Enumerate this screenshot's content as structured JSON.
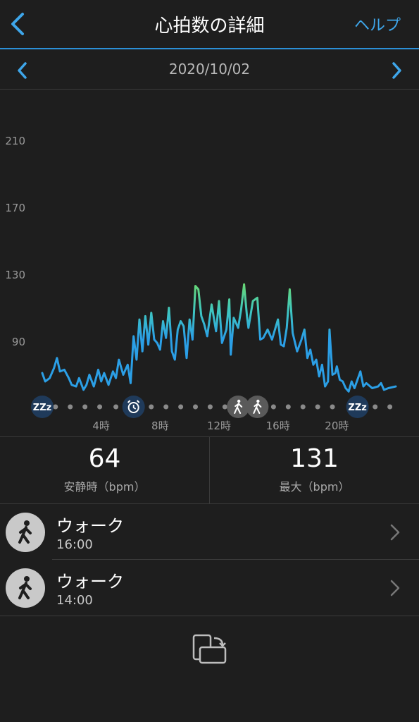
{
  "header": {
    "title": "心拍数の詳細",
    "help_label": "ヘルプ"
  },
  "datebar": {
    "date": "2020/10/02"
  },
  "colors": {
    "accent": "#3ea6ea",
    "line_low": "#2b9fe6",
    "line_high": "#7ee04a",
    "background": "#1e1e1e"
  },
  "chart_data": {
    "type": "line",
    "title": "",
    "xlabel": "",
    "ylabel": "",
    "x_unit": "hour",
    "xlim": [
      0,
      24
    ],
    "ylim": [
      50,
      220
    ],
    "y_ticks": [
      "210",
      "170",
      "130",
      "90"
    ],
    "y_tick_values": [
      210,
      170,
      130,
      90
    ],
    "x_ticks": [
      "4時",
      "8時",
      "12時",
      "16時",
      "20時"
    ],
    "x_tick_values": [
      4,
      8,
      12,
      16,
      20
    ],
    "grid": false,
    "series": [
      {
        "values": [
          [
            0.0,
            71
          ],
          [
            0.2,
            66
          ],
          [
            0.5,
            68
          ],
          [
            0.8,
            74
          ],
          [
            1.0,
            80
          ],
          [
            1.2,
            72
          ],
          [
            1.5,
            73
          ],
          [
            1.8,
            68
          ],
          [
            2.0,
            64
          ],
          [
            2.3,
            63
          ],
          [
            2.5,
            68
          ],
          [
            2.8,
            61
          ],
          [
            3.0,
            64
          ],
          [
            3.2,
            70
          ],
          [
            3.5,
            63
          ],
          [
            3.8,
            73
          ],
          [
            4.0,
            66
          ],
          [
            4.2,
            71
          ],
          [
            4.5,
            64
          ],
          [
            4.8,
            72
          ],
          [
            5.0,
            68
          ],
          [
            5.2,
            79
          ],
          [
            5.5,
            70
          ],
          [
            5.8,
            76
          ],
          [
            6.0,
            65
          ],
          [
            6.2,
            93
          ],
          [
            6.4,
            79
          ],
          [
            6.6,
            103
          ],
          [
            6.8,
            84
          ],
          [
            7.0,
            105
          ],
          [
            7.2,
            88
          ],
          [
            7.4,
            107
          ],
          [
            7.6,
            91
          ],
          [
            7.8,
            89
          ],
          [
            8.0,
            85
          ],
          [
            8.2,
            102
          ],
          [
            8.4,
            92
          ],
          [
            8.6,
            110
          ],
          [
            8.8,
            84
          ],
          [
            9.0,
            79
          ],
          [
            9.2,
            97
          ],
          [
            9.4,
            102
          ],
          [
            9.6,
            99
          ],
          [
            9.8,
            80
          ],
          [
            10.0,
            103
          ],
          [
            10.2,
            91
          ],
          [
            10.4,
            123
          ],
          [
            10.6,
            121
          ],
          [
            10.8,
            105
          ],
          [
            11.0,
            100
          ],
          [
            11.2,
            93
          ],
          [
            11.5,
            112
          ],
          [
            11.8,
            96
          ],
          [
            12.0,
            114
          ],
          [
            12.2,
            89
          ],
          [
            12.5,
            97
          ],
          [
            12.7,
            115
          ],
          [
            12.8,
            82
          ],
          [
            13.0,
            104
          ],
          [
            13.3,
            98
          ],
          [
            13.5,
            109
          ],
          [
            13.7,
            124
          ],
          [
            13.9,
            105
          ],
          [
            14.0,
            98
          ],
          [
            14.3,
            114
          ],
          [
            14.6,
            116
          ],
          [
            14.8,
            91
          ],
          [
            15.0,
            92
          ],
          [
            15.3,
            97
          ],
          [
            15.6,
            91
          ],
          [
            16.0,
            103
          ],
          [
            16.2,
            88
          ],
          [
            16.4,
            87
          ],
          [
            16.6,
            98
          ],
          [
            16.8,
            121
          ],
          [
            17.0,
            95
          ],
          [
            17.3,
            84
          ],
          [
            17.6,
            91
          ],
          [
            17.8,
            97
          ],
          [
            18.0,
            80
          ],
          [
            18.2,
            85
          ],
          [
            18.4,
            76
          ],
          [
            18.6,
            79
          ],
          [
            18.8,
            69
          ],
          [
            19.0,
            76
          ],
          [
            19.2,
            63
          ],
          [
            19.4,
            66
          ],
          [
            19.5,
            97
          ],
          [
            19.7,
            70
          ],
          [
            19.9,
            71
          ],
          [
            20.0,
            75
          ],
          [
            20.2,
            67
          ],
          [
            20.4,
            66
          ],
          [
            20.6,
            62
          ],
          [
            20.8,
            60
          ],
          [
            21.0,
            66
          ],
          [
            21.2,
            62
          ],
          [
            21.4,
            67
          ],
          [
            21.6,
            72
          ],
          [
            21.8,
            63
          ],
          [
            22.0,
            65
          ],
          [
            22.4,
            62
          ],
          [
            22.8,
            63
          ],
          [
            23.0,
            65
          ],
          [
            23.2,
            61
          ],
          [
            23.5,
            62
          ],
          [
            24.0,
            63
          ]
        ]
      }
    ],
    "event_markers": [
      {
        "x": 0.0,
        "icon": "sleep-icon",
        "glyph": "ZZz"
      },
      {
        "x": 6.2,
        "icon": "alarm-clock-icon"
      },
      {
        "x": 13.3,
        "icon": "walk-icon"
      },
      {
        "x": 14.6,
        "icon": "walk-icon"
      },
      {
        "x": 21.4,
        "icon": "sleep-icon",
        "glyph": "ZZz"
      }
    ],
    "dot_positions": [
      0.9,
      1.9,
      2.9,
      3.9,
      5.0,
      7.4,
      8.4,
      9.4,
      10.4,
      11.4,
      12.4,
      15.7,
      16.7,
      17.7,
      18.7,
      19.7,
      22.6,
      23.6
    ]
  },
  "stats": [
    {
      "value": "64",
      "label": "安静時（bpm）"
    },
    {
      "value": "131",
      "label": "最大（bpm）"
    }
  ],
  "activities": [
    {
      "name": "ウォーク",
      "time": "16:00",
      "icon": "walk-icon"
    },
    {
      "name": "ウォーク",
      "time": "14:00",
      "icon": "walk-icon"
    }
  ]
}
